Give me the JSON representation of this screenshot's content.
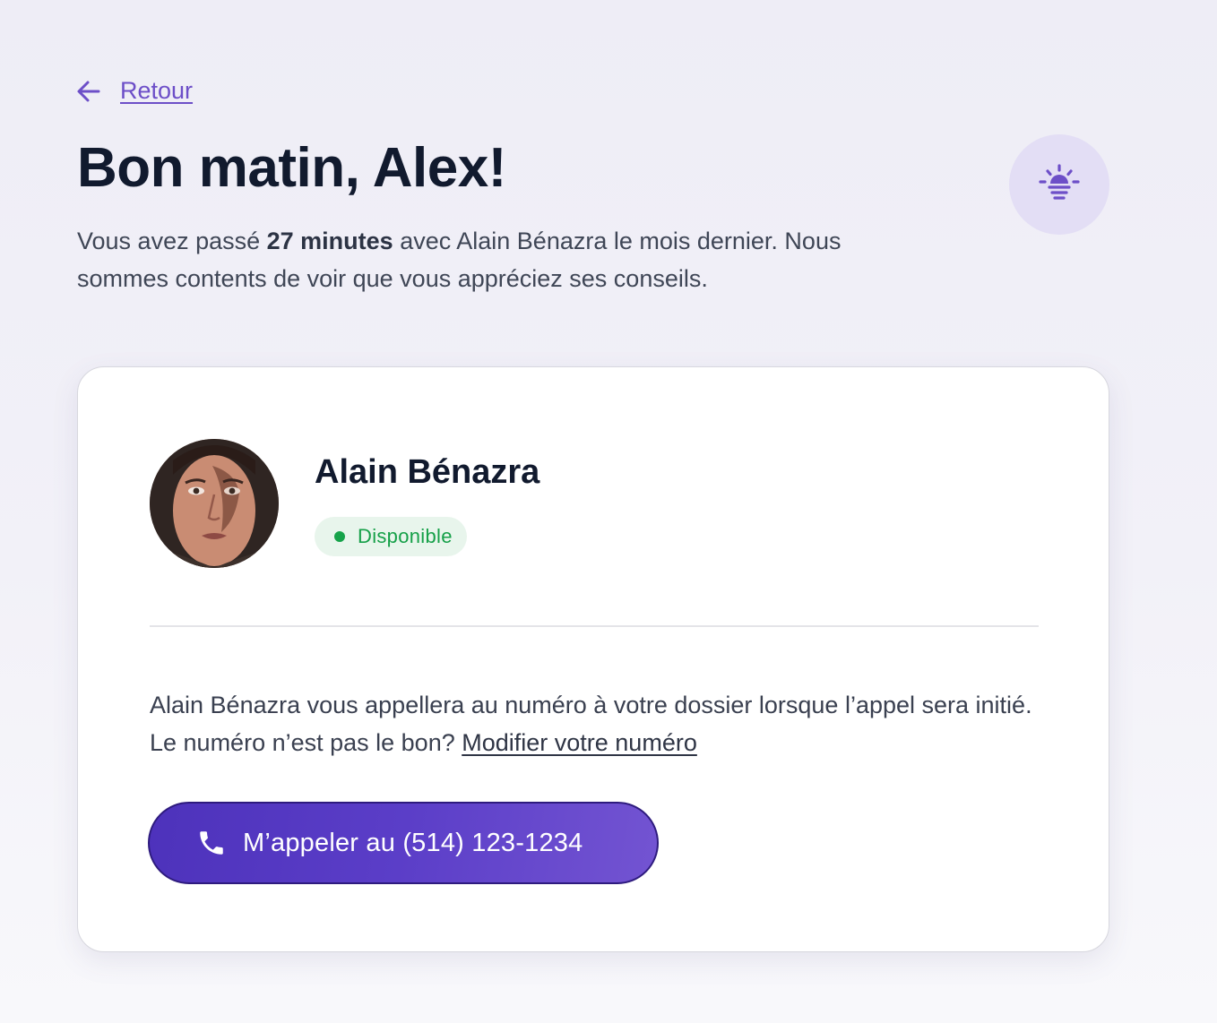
{
  "nav": {
    "back_label": "Retour",
    "back_icon": "arrow-left-icon"
  },
  "header": {
    "greeting": "Bon matin, Alex!",
    "intro_before": "Vous avez passé ",
    "intro_duration": "27 minutes",
    "intro_after": " avec Alain Bénazra le mois dernier. Nous sommes contents de voir que vous appréciez ses conseils.",
    "badge_icon": "sunrise-icon"
  },
  "advisor": {
    "name": "Alain Bénazra",
    "status": "Disponible",
    "status_color": "#16a34a",
    "description": "Alain Bénazra vous appellera au numéro à votre dossier lorsque l’appel sera initié. Le numéro n’est pas le bon? ",
    "edit_link": "Modifier votre numéro",
    "call_button_label": "M’appeler au (514) 123-1234",
    "call_icon": "phone-icon"
  },
  "colors": {
    "accent": "#6d4fc8",
    "button": "#5a3ec8",
    "title": "#111a2e"
  }
}
